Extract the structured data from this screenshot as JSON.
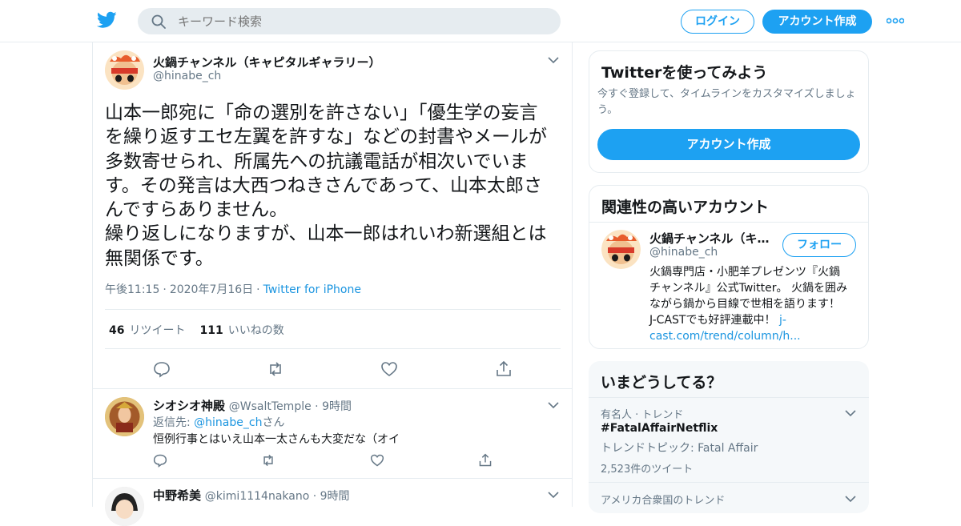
{
  "header": {
    "search_placeholder": "キーワード検索",
    "login_label": "ログイン",
    "signup_label": "アカウント作成",
    "brand_color": "#1DA1F2"
  },
  "tweet": {
    "author_name": "火鍋チャンネル（キャピタルギャラリー）",
    "author_handle": "@hinabe_ch",
    "text_lines": [
      "山本一郎宛に「命の選別を許さない」「優生学の妄言",
      "を繰り返すエセ左翼を許すな」などの封書やメールが",
      "多数寄せられ、所属先への抗議電話が相次いでいま",
      "す。その発言は大西つねきさんであって、山本太郎さ",
      "んですらありません。",
      "繰り返しになりますが、山本一郎はれいわ新選組とは",
      "無関係です。"
    ],
    "time": "午後11:15",
    "date": "2020年7月16日",
    "source": "Twitter for iPhone",
    "retweets_count": "46",
    "retweets_label": "リツイート",
    "likes_count": "111",
    "likes_label": "いいねの数"
  },
  "replies": [
    {
      "name": "シオシオ神殿",
      "handle": "@WsaltTemple",
      "time": "9時間",
      "reply_to_prefix": "返信先: ",
      "reply_to_handle": "@hinabe_ch",
      "reply_to_suffix": "さん",
      "text": "恒例行事とはいえ山本一太さんも大変だな（オイ"
    },
    {
      "name": "中野希美",
      "handle": "@kimi1114nakano",
      "time": "9時間"
    }
  ],
  "sidebar": {
    "try_card": {
      "title": "Twitterを使ってみよう",
      "desc_line1": "今すぐ登録して、タイムラインをカスタマイズしましょ",
      "desc_line2": "う。",
      "button_label": "アカウント作成"
    },
    "related_card": {
      "title": "関連性の高いアカウント",
      "name": "火鍋チャンネル（キ…",
      "handle": "@hinabe_ch",
      "follow_label": "フォロー",
      "bio_line1": "火鍋専門店・小肥羊プレゼンツ『火鍋",
      "bio_line2": "チャンネル』公式Twitter。 火鍋を囲み",
      "bio_line3": "ながら鍋から目線で世相を語ります！",
      "bio_line4": "J-CASTでも好評連載中！",
      "link_part1": "j-",
      "link_part2": "cast.com/trend/column/h..."
    },
    "trends_card": {
      "title": "いまどうしてる？",
      "trends": [
        {
          "context": "有名人 · トレンド",
          "name": "#FatalAffairNetflix",
          "topic": "トレンドトピック: Fatal Affair",
          "count": "2,523件のツイート"
        },
        {
          "context": "アメリカ合衆国のトレンド"
        }
      ]
    }
  }
}
